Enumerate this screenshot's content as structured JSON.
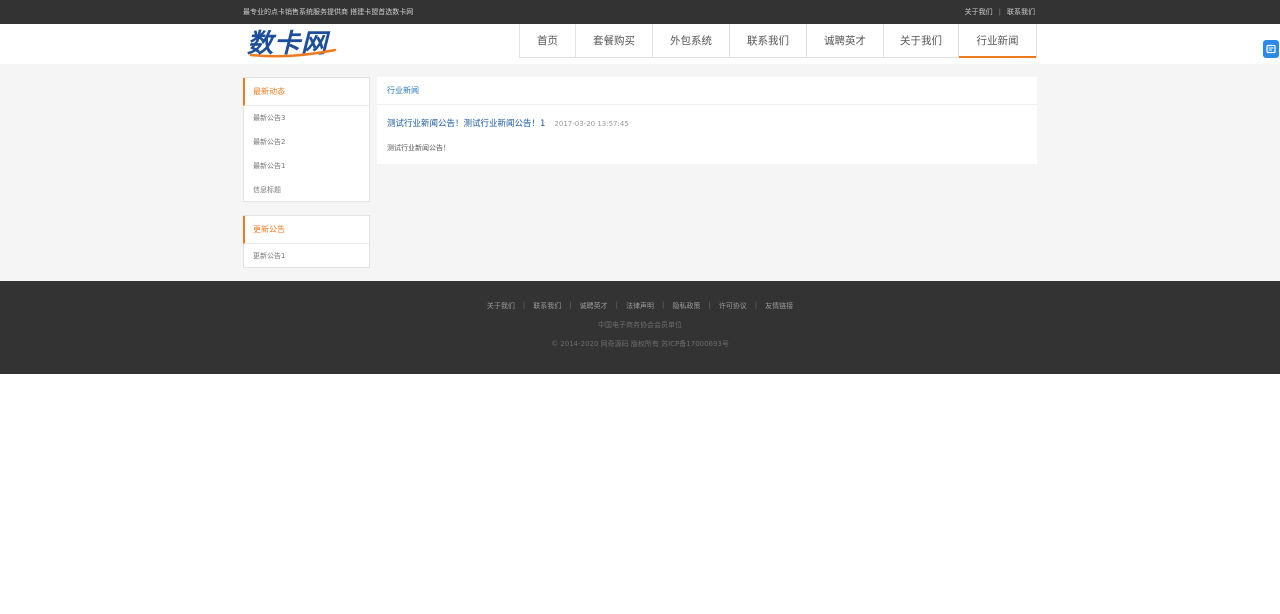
{
  "topbar": {
    "slogan": "最专业的点卡销售系统服务提供商 搭建卡盟首选数卡网",
    "links": [
      "关于我们",
      "联系我们"
    ],
    "separator": "|"
  },
  "logo": {
    "text": "数卡网"
  },
  "nav": [
    {
      "label": "首页",
      "width": 56
    },
    {
      "label": "套餐购买",
      "width": 77
    },
    {
      "label": "外包系统",
      "width": 77
    },
    {
      "label": "联系我们",
      "width": 77
    },
    {
      "label": "诚聘英才",
      "width": 77
    },
    {
      "label": "关于我们",
      "width": 75
    },
    {
      "label": "行业新闻",
      "width": 77,
      "active": true
    }
  ],
  "sidebar": {
    "box1": {
      "title": "最新动态",
      "items": [
        "最新公告3",
        "最新公告2",
        "最新公告1",
        "信息标题"
      ]
    },
    "box2": {
      "title": "更新公告",
      "items": [
        "更新公告1"
      ]
    }
  },
  "main": {
    "title": "行业新闻",
    "news": [
      {
        "title": "测试行业新闻公告！测试行业新闻公告！1",
        "date": "2017-03-20 13:57:45",
        "desc": "测试行业新闻公告！"
      }
    ]
  },
  "footer": {
    "links": [
      "关于我们",
      "联系我们",
      "诚聘英才",
      "法律声明",
      "隐私政策",
      "许可协议",
      "友情链接"
    ],
    "separator": "|",
    "line1": "中国电子商务协会会员单位",
    "line2": "© 2014-2020 网奇源码 版权所有 苏ICP备17000693号"
  },
  "colors": {
    "accent": "#f07a1e",
    "link_blue": "#1d5aa3",
    "dark_bar": "#333333"
  }
}
